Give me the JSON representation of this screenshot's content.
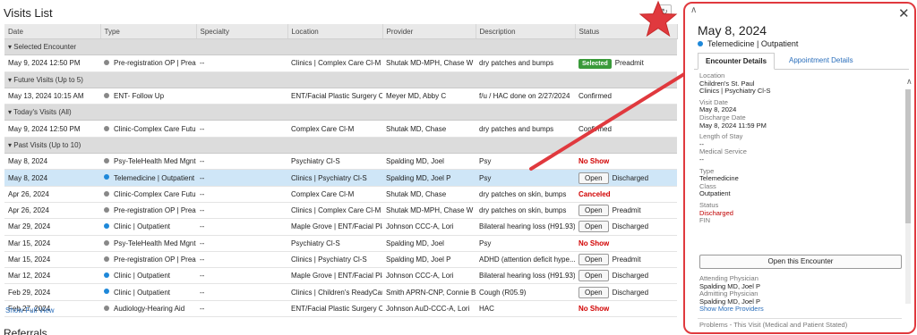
{
  "visits_list": {
    "title": "Visits List",
    "refresh_icon": "refresh-icon",
    "columns": [
      "Date",
      "Type",
      "Specialty",
      "Location",
      "Provider",
      "Description",
      "Status"
    ],
    "groups": [
      {
        "label": "Selected Encounter",
        "rows": [
          {
            "date": "May 9, 2024 12:50 PM",
            "dot": "gray",
            "type": "Pre-registration OP | Prea...",
            "specialty": "--",
            "location": "Clinics | Complex Care Cl-M",
            "provider": "Shutak MD-MPH, Chase W",
            "description": "dry patches and bumps",
            "status_badge": "Selected",
            "status": "Preadmit"
          }
        ]
      },
      {
        "label": "Future Visits (Up to 5)",
        "rows": [
          {
            "date": "May 13, 2024 10:15 AM",
            "dot": "gray",
            "type": "ENT- Follow Up",
            "specialty": "",
            "location": "ENT/Facial Plastic Surgery Cl-M",
            "provider": "Meyer MD, Abby C",
            "description": "f/u / HAC done on 2/27/2024",
            "status": "Confirmed"
          }
        ]
      },
      {
        "label": "Today's Visits (All)",
        "rows": [
          {
            "date": "May 9, 2024 12:50 PM",
            "dot": "gray",
            "type": "Clinic-Complex Care Future",
            "specialty": "--",
            "location": "Complex Care Cl-M",
            "provider": "Shutak MD, Chase",
            "description": "dry patches and bumps",
            "status": "Confirmed"
          }
        ]
      },
      {
        "label": "Past Visits (Up to 10)",
        "rows": [
          {
            "date": "May 8, 2024",
            "dot": "gray",
            "type": "Psy-TeleHealth Med Mgnt",
            "specialty": "--",
            "location": "Psychiatry Cl-S",
            "provider": "Spalding MD, Joel",
            "description": "Psy",
            "status": "No Show"
          },
          {
            "date": "May 8, 2024",
            "dot": "blue",
            "type": "Telemedicine | Outpatient",
            "specialty": "--",
            "location": "Clinics | Psychiatry Cl-S",
            "provider": "Spalding MD, Joel P",
            "description": "Psy",
            "open": "Open",
            "status": "Discharged"
          },
          {
            "date": "Apr 26, 2024",
            "dot": "gray",
            "type": "Clinic-Complex Care Future",
            "specialty": "--",
            "location": "Complex Care Cl-M",
            "provider": "Shutak MD, Chase",
            "description": "dry patches on skin, bumps",
            "status": "Canceled"
          },
          {
            "date": "Apr 26, 2024",
            "dot": "gray",
            "type": "Pre-registration OP | Prea...",
            "specialty": "--",
            "location": "Clinics | Complex Care Cl-M",
            "provider": "Shutak MD-MPH, Chase W",
            "description": "dry patches on skin, bumps",
            "open": "Open",
            "status": "Preadmit"
          },
          {
            "date": "Mar 29, 2024",
            "dot": "blue",
            "type": "Clinic | Outpatient",
            "specialty": "--",
            "location": "Maple Grove | ENT/Facial Pla...",
            "provider": "Johnson CCC-A, Lori",
            "description": "Bilateral hearing loss (H91.93)",
            "open": "Open",
            "status": "Discharged"
          },
          {
            "date": "Mar 15, 2024",
            "dot": "gray",
            "type": "Psy-TeleHealth Med Mgnt",
            "specialty": "--",
            "location": "Psychiatry Cl-S",
            "provider": "Spalding MD, Joel",
            "description": "Psy",
            "status": "No Show"
          },
          {
            "date": "Mar 15, 2024",
            "dot": "gray",
            "type": "Pre-registration OP | Prea...",
            "specialty": "--",
            "location": "Clinics | Psychiatry Cl-S",
            "provider": "Spalding MD, Joel P",
            "description": "ADHD (attention deficit hype...",
            "open": "Open",
            "status": "Preadmit"
          },
          {
            "date": "Mar 12, 2024",
            "dot": "blue",
            "type": "Clinic | Outpatient",
            "specialty": "--",
            "location": "Maple Grove | ENT/Facial Pla...",
            "provider": "Johnson CCC-A, Lori",
            "description": "Bilateral hearing loss (H91.93)",
            "open": "Open",
            "status": "Discharged"
          },
          {
            "date": "Feb 29, 2024",
            "dot": "blue",
            "type": "Clinic | Outpatient",
            "specialty": "--",
            "location": "Clinics | Children's ReadyCar...",
            "provider": "Smith APRN-CNP, Connie B",
            "description": "Cough (R05.9)",
            "open": "Open",
            "status": "Discharged"
          },
          {
            "date": "Feb 27, 2024",
            "dot": "gray",
            "type": "Audiology-Hearing Aid",
            "specialty": "--",
            "location": "ENT/Facial Plastic Surgery Cl...",
            "provider": "Johnson AuD-CCC-A, Lori",
            "description": "HAC",
            "status": "No Show"
          }
        ]
      }
    ],
    "show_full_view": "Show Full View",
    "referrals_title": "Referrals"
  },
  "panel": {
    "date": "May 8, 2024",
    "type": "Telemedicine | Outpatient",
    "tabs": [
      "Encounter Details",
      "Appointment Details"
    ],
    "location_label": "Location",
    "location_line1": "Children's St. Paul",
    "location_line2": "Clinics | Psychiatry Cl-S",
    "visit_date_label": "Visit Date",
    "visit_date": "May 8, 2024",
    "discharge_date_label": "Discharge Date",
    "discharge_date": "May 8, 2024 11:59 PM",
    "length_of_stay_label": "Length of Stay",
    "length_of_stay": "--",
    "medical_service_label": "Medical Service",
    "medical_service": "--",
    "type_label": "Type",
    "type_value": "Telemedicine",
    "class_label": "Class",
    "class_value": "Outpatient",
    "status_label": "Status",
    "status_value": "Discharged",
    "fin_label": "FIN",
    "open_encounter": "Open this Encounter",
    "attending_label": "Attending Physician",
    "attending": "Spalding MD, Joel P",
    "admitting_label": "Admitting Physician",
    "admitting": "Spalding MD, Joel P",
    "show_more": "Show More Providers",
    "problems": "Problems - This Visit (Medical and Patient Stated)"
  },
  "colors": {
    "selected_row": "#cfe6f7",
    "annotation_red": "#e0393e",
    "status_red": "#d10000",
    "selected_badge": "#3a9a3a",
    "dot_blue": "#1e88d9",
    "dot_gray": "#888888"
  }
}
